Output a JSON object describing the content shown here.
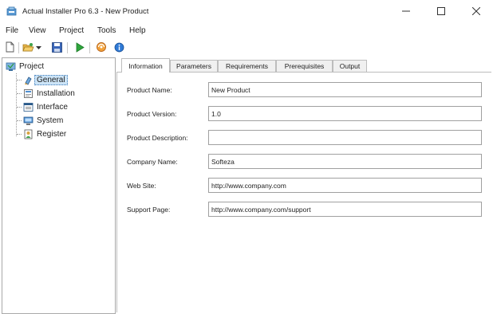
{
  "window": {
    "title": "Actual Installer Pro 6.3 - New Product",
    "controls": {
      "minimize": "—",
      "maximize": "☐",
      "close": "✕"
    }
  },
  "menu": {
    "items": [
      {
        "label": "File"
      },
      {
        "label": "View"
      },
      {
        "label": "Project"
      },
      {
        "label": "Tools"
      },
      {
        "label": "Help"
      }
    ]
  },
  "toolbar": {
    "buttons": [
      {
        "icon": "new-file-icon"
      },
      {
        "icon": "open-folder-icon"
      },
      {
        "icon": "dropdown-arrow-icon"
      },
      {
        "icon": "save-icon"
      },
      {
        "icon": "build-run-icon"
      },
      {
        "icon": "web-update-icon"
      },
      {
        "icon": "about-info-icon"
      }
    ]
  },
  "tree": {
    "root": {
      "label": "Project",
      "icon": "project-icon"
    },
    "items": [
      {
        "label": "General",
        "icon": "general-icon",
        "selected": true
      },
      {
        "label": "Installation",
        "icon": "installation-icon"
      },
      {
        "label": "Interface",
        "icon": "interface-icon"
      },
      {
        "label": "System",
        "icon": "system-icon"
      },
      {
        "label": "Register",
        "icon": "register-icon"
      }
    ]
  },
  "tabs": [
    {
      "label": "Information",
      "active": true
    },
    {
      "label": "Parameters"
    },
    {
      "label": "Requirements"
    },
    {
      "label": "Prerequisites"
    },
    {
      "label": "Output"
    }
  ],
  "form": {
    "fields": [
      {
        "label": "Product Name:",
        "value": "New Product"
      },
      {
        "label": "Product Version:",
        "value": "1.0"
      },
      {
        "label": "Product Description:",
        "value": ""
      },
      {
        "label": "Company Name:",
        "value": "Softeza"
      },
      {
        "label": "Web Site:",
        "value": "http://www.company.com"
      },
      {
        "label": "Support Page:",
        "value": "http://www.company.com/support"
      }
    ]
  },
  "colors": {
    "selection": "#cce4f7",
    "tab_strip": "#f0f0f0",
    "border": "#a9a9a9"
  }
}
